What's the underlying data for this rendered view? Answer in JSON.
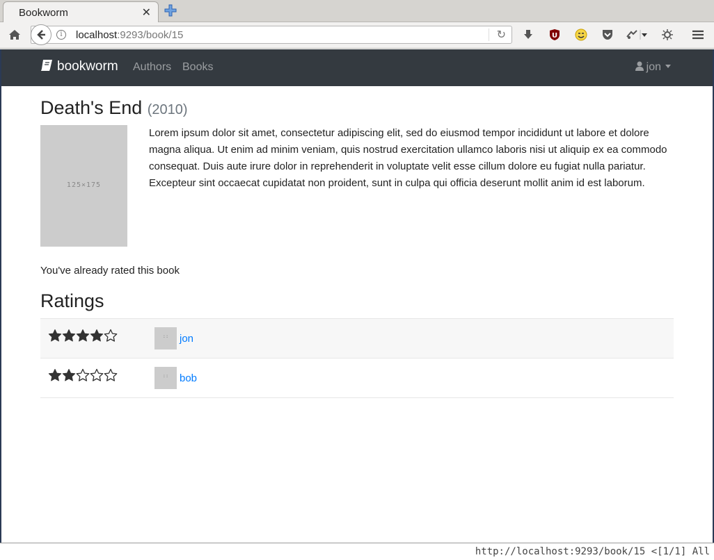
{
  "browser": {
    "tab_title": "Bookworm",
    "url_host": "localhost",
    "url_rest": ":9293/book/15",
    "status_url": "http://localhost:9293/book/15 <[1/1] All"
  },
  "navbar": {
    "brand": "bookworm",
    "links": [
      "Authors",
      "Books"
    ],
    "user": "jon"
  },
  "book": {
    "title": "Death's End",
    "year": "(2010)",
    "cover_placeholder": "125×175",
    "description": "Lorem ipsum dolor sit amet, consectetur adipiscing elit, sed do eiusmod tempor incididunt ut labore et dolore magna aliqua. Ut enim ad minim veniam, quis nostrud exercitation ullamco laboris nisi ut aliquip ex ea commodo consequat. Duis aute irure dolor in reprehenderit in voluptate velit esse cillum dolore eu fugiat nulla pariatur. Excepteur sint occaecat cupidatat non proident, sunt in culpa qui officia deserunt mollit anim id est laborum.",
    "rated_message": "You've already rated this book"
  },
  "ratings": {
    "heading": "Ratings",
    "max_stars": 5,
    "avatar_placeholder": "::",
    "rows": [
      {
        "stars": 4,
        "user": "jon"
      },
      {
        "stars": 2,
        "user": "bob"
      }
    ]
  },
  "colors": {
    "navbar_bg": "#343a40",
    "link": "#007bff",
    "star": "#333333"
  }
}
